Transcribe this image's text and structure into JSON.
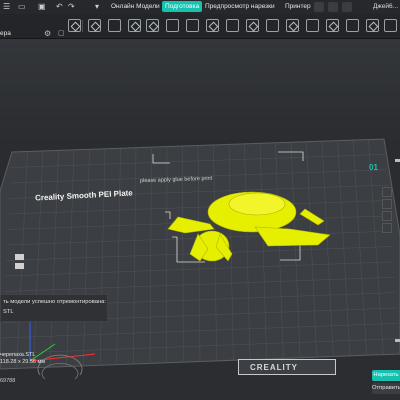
{
  "titlebar": {
    "tabs": [
      {
        "label": "Онлайн Модели",
        "active": false
      },
      {
        "label": "Подготовка",
        "active": true
      },
      {
        "label": "Предпросмотр нарезки",
        "active": false
      },
      {
        "label": "Принтер",
        "active": false
      }
    ],
    "user": "Джей6..."
  },
  "left_panel": {
    "label": "ера"
  },
  "plate": {
    "name": "Creality Smooth PEI Plate",
    "glue_hint": "please apply glue before print",
    "badge": "01",
    "brand": "CREALITY"
  },
  "notification": {
    "line1": "ть модели успешно отремонтирована:",
    "line2": "STL"
  },
  "model_info": {
    "file_name": "черепаха.STL",
    "size": "118.28 x 29.56 мм",
    "line3": "69788"
  },
  "buttons": {
    "slice_label": "Нарезать",
    "send_label": "Отправить"
  },
  "colors": {
    "accent": "#17c1b0",
    "model": "#e6ef00",
    "plate": "#3b3e42"
  }
}
